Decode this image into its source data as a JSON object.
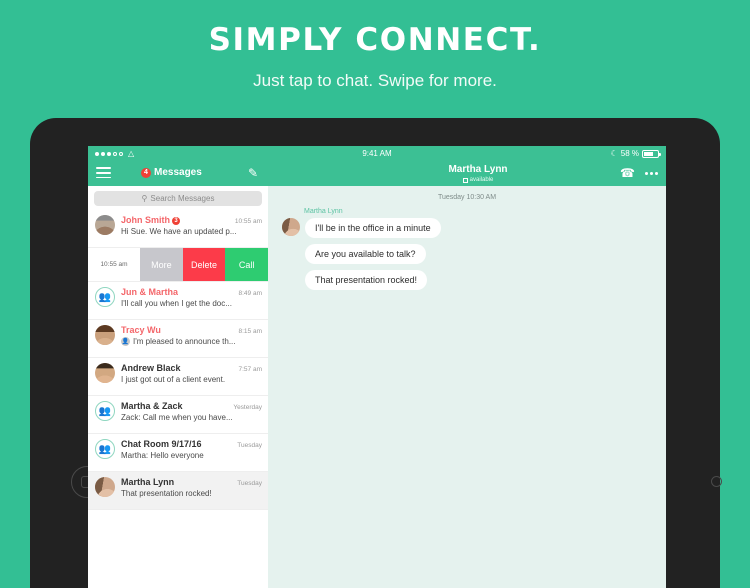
{
  "promo": {
    "title": "SIMPLY CONNECT.",
    "subtitle": "Just tap to chat. Swipe for more."
  },
  "colors": {
    "brand_teal": "#33bf94",
    "navbar_green": "#3cc094",
    "chat_bg": "#e5f2ee",
    "badge_red": "#ef4136",
    "delete_red": "#fc3b49",
    "call_green": "#2ecc71",
    "more_gray": "#c7c7cc",
    "unread_name": "#f4676b",
    "bezel": "#222222"
  },
  "statusbar": {
    "signal_dots_filled": 3,
    "signal_dots_total": 5,
    "wifi_icon": "wifi-icon",
    "time": "9:41 AM",
    "bluetooth_icon": "bluetooth-icon",
    "battery_percent": "58 %"
  },
  "navbar": {
    "menu_icon": "hamburger-menu-icon",
    "messages_badge": "4",
    "messages_label": "Messages",
    "compose_icon": "pencil-icon",
    "contact_name": "Martha Lynn",
    "contact_status": "available",
    "call_icon": "phone-icon",
    "more_icon": "ellipsis-icon"
  },
  "search": {
    "icon": "search-icon",
    "placeholder": "Search Messages"
  },
  "swipe_actions": {
    "time": "10:55 am",
    "more_label": "More",
    "delete_label": "Delete",
    "call_label": "Call"
  },
  "conversations": [
    {
      "name": "John Smith",
      "badge": "3",
      "time": "10:55 am",
      "preview": "Hi Sue. We have an updated p...",
      "avatar": "photo-john",
      "unread": true,
      "selected": false,
      "prefix_icon": ""
    },
    {
      "name": "Jun & Martha",
      "badge": "",
      "time": "8:49 am",
      "preview": "I'll call you when I get the doc...",
      "avatar": "group-icon",
      "unread": true,
      "selected": false,
      "prefix_icon": ""
    },
    {
      "name": "Tracy Wu",
      "badge": "",
      "time": "8:15 am",
      "preview": "I'm pleased to announce th...",
      "avatar": "photo-tracy",
      "unread": true,
      "selected": false,
      "prefix_icon": "person-icon"
    },
    {
      "name": "Andrew Black",
      "badge": "",
      "time": "7:57 am",
      "preview": "I just got out of a client event.",
      "avatar": "photo-andrew",
      "unread": false,
      "selected": false,
      "prefix_icon": ""
    },
    {
      "name": "Martha & Zack",
      "badge": "",
      "time": "Yesterday",
      "preview": "Zack: Call me when you have...",
      "avatar": "group-icon",
      "unread": false,
      "selected": false,
      "prefix_icon": ""
    },
    {
      "name": "Chat Room 9/17/16",
      "badge": "",
      "time": "Tuesday",
      "preview": "Martha: Hello everyone",
      "avatar": "group-icon",
      "unread": false,
      "selected": false,
      "prefix_icon": ""
    },
    {
      "name": "Martha Lynn",
      "badge": "",
      "time": "Tuesday",
      "preview": "That presentation rocked!",
      "avatar": "photo-martha",
      "unread": false,
      "selected": true,
      "prefix_icon": ""
    }
  ],
  "chat": {
    "daystamp": "Tuesday 10:30 AM",
    "sender": "Martha Lynn",
    "messages": [
      "I'll be in the office in a minute",
      "Are you available to talk?",
      "That presentation rocked!"
    ]
  }
}
